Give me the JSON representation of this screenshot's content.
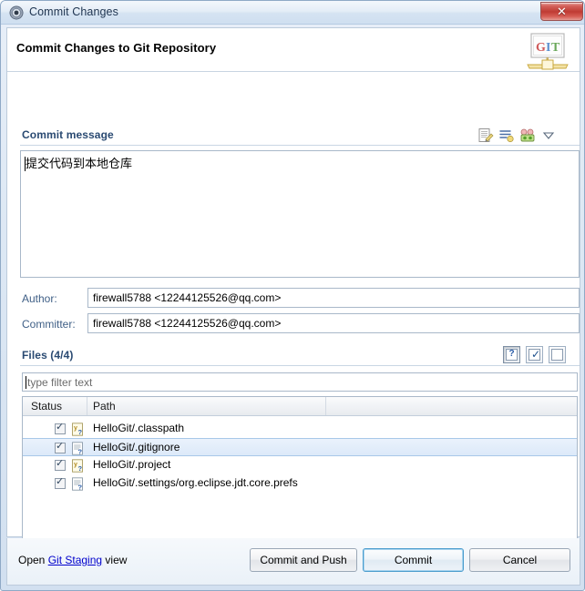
{
  "window": {
    "title": "Commit Changes",
    "icon": "eclipse-gear-icon",
    "close_label": "✕"
  },
  "header": {
    "title": "Commit Changes to Git Repository",
    "logo": "git-logo-icon",
    "logo_text": "GIT"
  },
  "commit_message": {
    "section_title": "Commit message",
    "text": "提交代码到本地仓库",
    "tools": [
      {
        "name": "add-signed-off-by-icon"
      },
      {
        "name": "add-change-id-icon"
      },
      {
        "name": "amend-previous-commit-icon"
      },
      {
        "name": "chevron-down-icon"
      }
    ]
  },
  "author": {
    "label": "Author:",
    "value": "firewall5788 <12244125526@qq.com>"
  },
  "committer": {
    "label": "Committer:",
    "value": "firewall5788 <12244125526@qq.com>"
  },
  "files": {
    "section_title": "Files (4/4)",
    "tools": [
      {
        "name": "show-untracked-files-button",
        "glyph": "?"
      },
      {
        "name": "select-all-button",
        "glyph": "✓"
      },
      {
        "name": "deselect-all-button",
        "glyph": ""
      }
    ],
    "filter": {
      "placeholder": "type filter text",
      "value": ""
    },
    "columns": [
      "Status",
      "Path"
    ],
    "rows": [
      {
        "checked": true,
        "icon": "xml-file-untracked-icon",
        "path": "HelloGit/.classpath",
        "selected": false
      },
      {
        "checked": true,
        "icon": "text-file-untracked-icon",
        "path": "HelloGit/.gitignore",
        "selected": true
      },
      {
        "checked": true,
        "icon": "xml-file-untracked-icon",
        "path": "HelloGit/.project",
        "selected": false
      },
      {
        "checked": true,
        "icon": "text-file-untracked-icon",
        "path": "HelloGit/.settings/org.eclipse.jdt.core.prefs",
        "selected": false
      }
    ]
  },
  "footer": {
    "open_prefix": "Open ",
    "link_label": "Git Staging",
    "open_suffix": " view",
    "buttons": {
      "commit_and_push": "Commit and Push",
      "commit": "Commit",
      "cancel": "Cancel"
    }
  },
  "colors": {
    "section_heading": "#2a4a72",
    "link": "#0000cc",
    "selection": "#dce9f9",
    "close_button": "#bf3b33"
  }
}
